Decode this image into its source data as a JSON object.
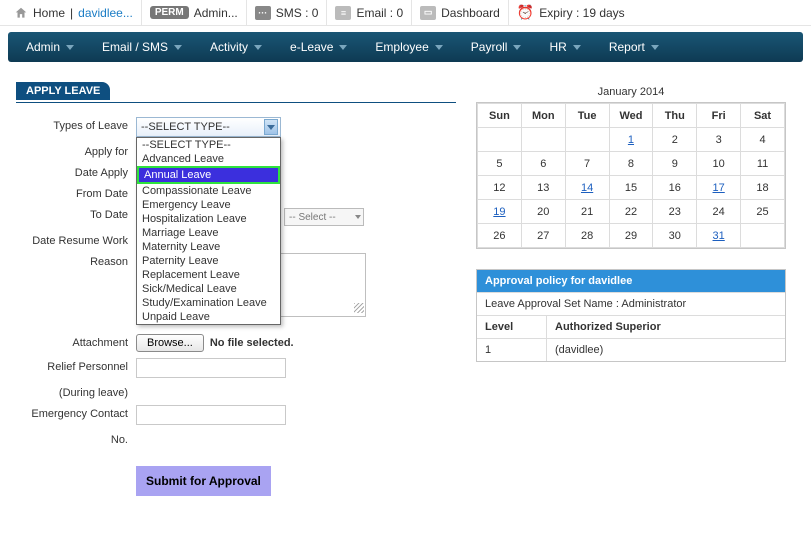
{
  "topbar": {
    "home_label": "Home",
    "user_link": "davidlee...",
    "perm_badge": "PERM",
    "admin_label": "Admin...",
    "sms_label": "SMS : 0",
    "email_label": "Email : 0",
    "dashboard_label": "Dashboard",
    "expiry_label": "Expiry : 19 days"
  },
  "nav": {
    "items": [
      "Admin",
      "Email / SMS",
      "Activity",
      "e-Leave",
      "Employee",
      "Payroll",
      "HR",
      "Report"
    ]
  },
  "form": {
    "panel_title": "APPLY LEAVE",
    "labels": {
      "types": "Types of Leave",
      "apply_for": "Apply for",
      "date_apply": "Date Apply",
      "from_date": "From Date",
      "to_date": "To Date",
      "resume": "Date Resume Work",
      "reason": "Reason",
      "attachment": "Attachment",
      "relief": "Relief Personnel",
      "relief2": "(During leave)",
      "emerg1": "Emergency Contact",
      "emerg2": "No."
    },
    "type_select_value": "--SELECT TYPE--",
    "ghost_select_value": "-- Select --",
    "type_options": [
      "--SELECT TYPE--",
      "Advanced Leave",
      "Annual Leave",
      "Compassionate Leave",
      "Emergency Leave",
      "Hospitalization Leave",
      "Marriage Leave",
      "Maternity Leave",
      "Paternity Leave",
      "Replacement Leave",
      "Sick/Medical Leave",
      "Study/Examination Leave",
      "Unpaid Leave"
    ],
    "type_highlight_index": 2,
    "browse_label": "Browse...",
    "no_file_label": "No file selected.",
    "submit_label": "Submit for Approval"
  },
  "calendar": {
    "title": "January 2014",
    "day_headers": [
      "Sun",
      "Mon",
      "Tue",
      "Wed",
      "Thu",
      "Fri",
      "Sat"
    ],
    "weeks": [
      [
        {
          "v": ""
        },
        {
          "v": ""
        },
        {
          "v": ""
        },
        {
          "v": "1",
          "l": true
        },
        {
          "v": "2"
        },
        {
          "v": "3"
        },
        {
          "v": "4"
        }
      ],
      [
        {
          "v": "5"
        },
        {
          "v": "6"
        },
        {
          "v": "7"
        },
        {
          "v": "8"
        },
        {
          "v": "9"
        },
        {
          "v": "10"
        },
        {
          "v": "11"
        }
      ],
      [
        {
          "v": "12"
        },
        {
          "v": "13"
        },
        {
          "v": "14",
          "l": true
        },
        {
          "v": "15"
        },
        {
          "v": "16"
        },
        {
          "v": "17",
          "l": true
        },
        {
          "v": "18"
        }
      ],
      [
        {
          "v": "19",
          "l": true
        },
        {
          "v": "20"
        },
        {
          "v": "21"
        },
        {
          "v": "22"
        },
        {
          "v": "23"
        },
        {
          "v": "24"
        },
        {
          "v": "25"
        }
      ],
      [
        {
          "v": "26"
        },
        {
          "v": "27"
        },
        {
          "v": "28"
        },
        {
          "v": "29"
        },
        {
          "v": "30"
        },
        {
          "v": "31",
          "l": true
        },
        {
          "v": ""
        }
      ]
    ]
  },
  "policy": {
    "header": "Approval policy for davidlee",
    "set_name_label": "Leave Approval Set Name : Administrator",
    "col_level": "Level",
    "col_auth": "Authorized Superior",
    "rows": [
      {
        "level": "1",
        "auth": "(davidlee)"
      }
    ]
  }
}
